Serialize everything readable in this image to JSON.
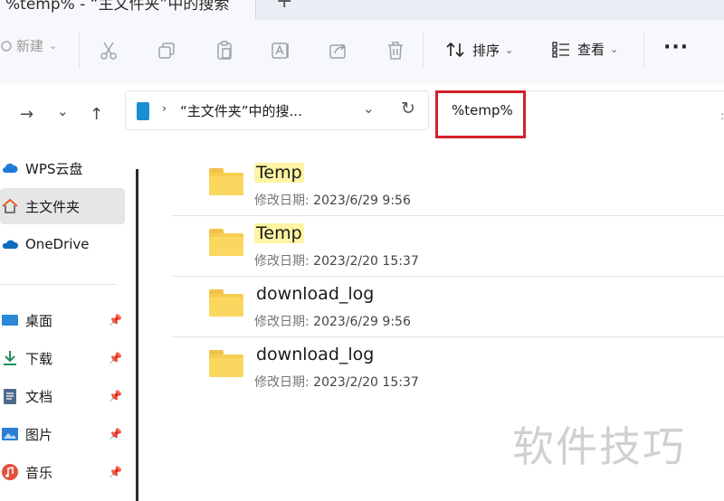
{
  "window": {
    "tab_title": "%temp% - “主文件夹”中的搜索",
    "new_tab": "+"
  },
  "toolbar": {
    "new_label": "新建",
    "sort_label": "排序",
    "view_label": "查看",
    "more_label": "···",
    "icons": [
      "cut-icon",
      "copy-icon",
      "paste-icon",
      "rename-icon",
      "share-icon",
      "delete-icon"
    ]
  },
  "address": {
    "breadcrumb": "“主文件夹”中的搜...",
    "search_value": "%temp%"
  },
  "sidebar": {
    "items": [
      {
        "label": "WPS云盘",
        "icon": "cloud-icon",
        "pinned": false
      },
      {
        "label": "主文件夹",
        "icon": "home-icon",
        "pinned": false,
        "active": true
      },
      {
        "label": "OneDrive",
        "icon": "onedrive-icon",
        "pinned": false
      },
      {
        "label": "桌面",
        "icon": "desktop-icon",
        "pinned": true
      },
      {
        "label": "下载",
        "icon": "download-icon",
        "pinned": true
      },
      {
        "label": "文档",
        "icon": "document-icon",
        "pinned": true
      },
      {
        "label": "图片",
        "icon": "picture-icon",
        "pinned": true
      },
      {
        "label": "音乐",
        "icon": "music-icon",
        "pinned": true
      }
    ]
  },
  "files": [
    {
      "name": "Temp",
      "date_label": "修改日期:",
      "date": "2023/6/29 9:56",
      "highlight": true
    },
    {
      "name": "Temp",
      "date_label": "修改日期:",
      "date": "2023/2/20 15:37",
      "highlight": true
    },
    {
      "name": "download_log",
      "date_label": "修改日期:",
      "date": "2023/6/29 9:56",
      "highlight": false
    },
    {
      "name": "download_log",
      "date_label": "修改日期:",
      "date": "2023/2/20 15:37",
      "highlight": false
    }
  ],
  "watermark": "软件技巧",
  "colors": {
    "accent_highlight": "#d4202a",
    "search_match": "#fef4a3",
    "folder": "#f7cd4f"
  }
}
